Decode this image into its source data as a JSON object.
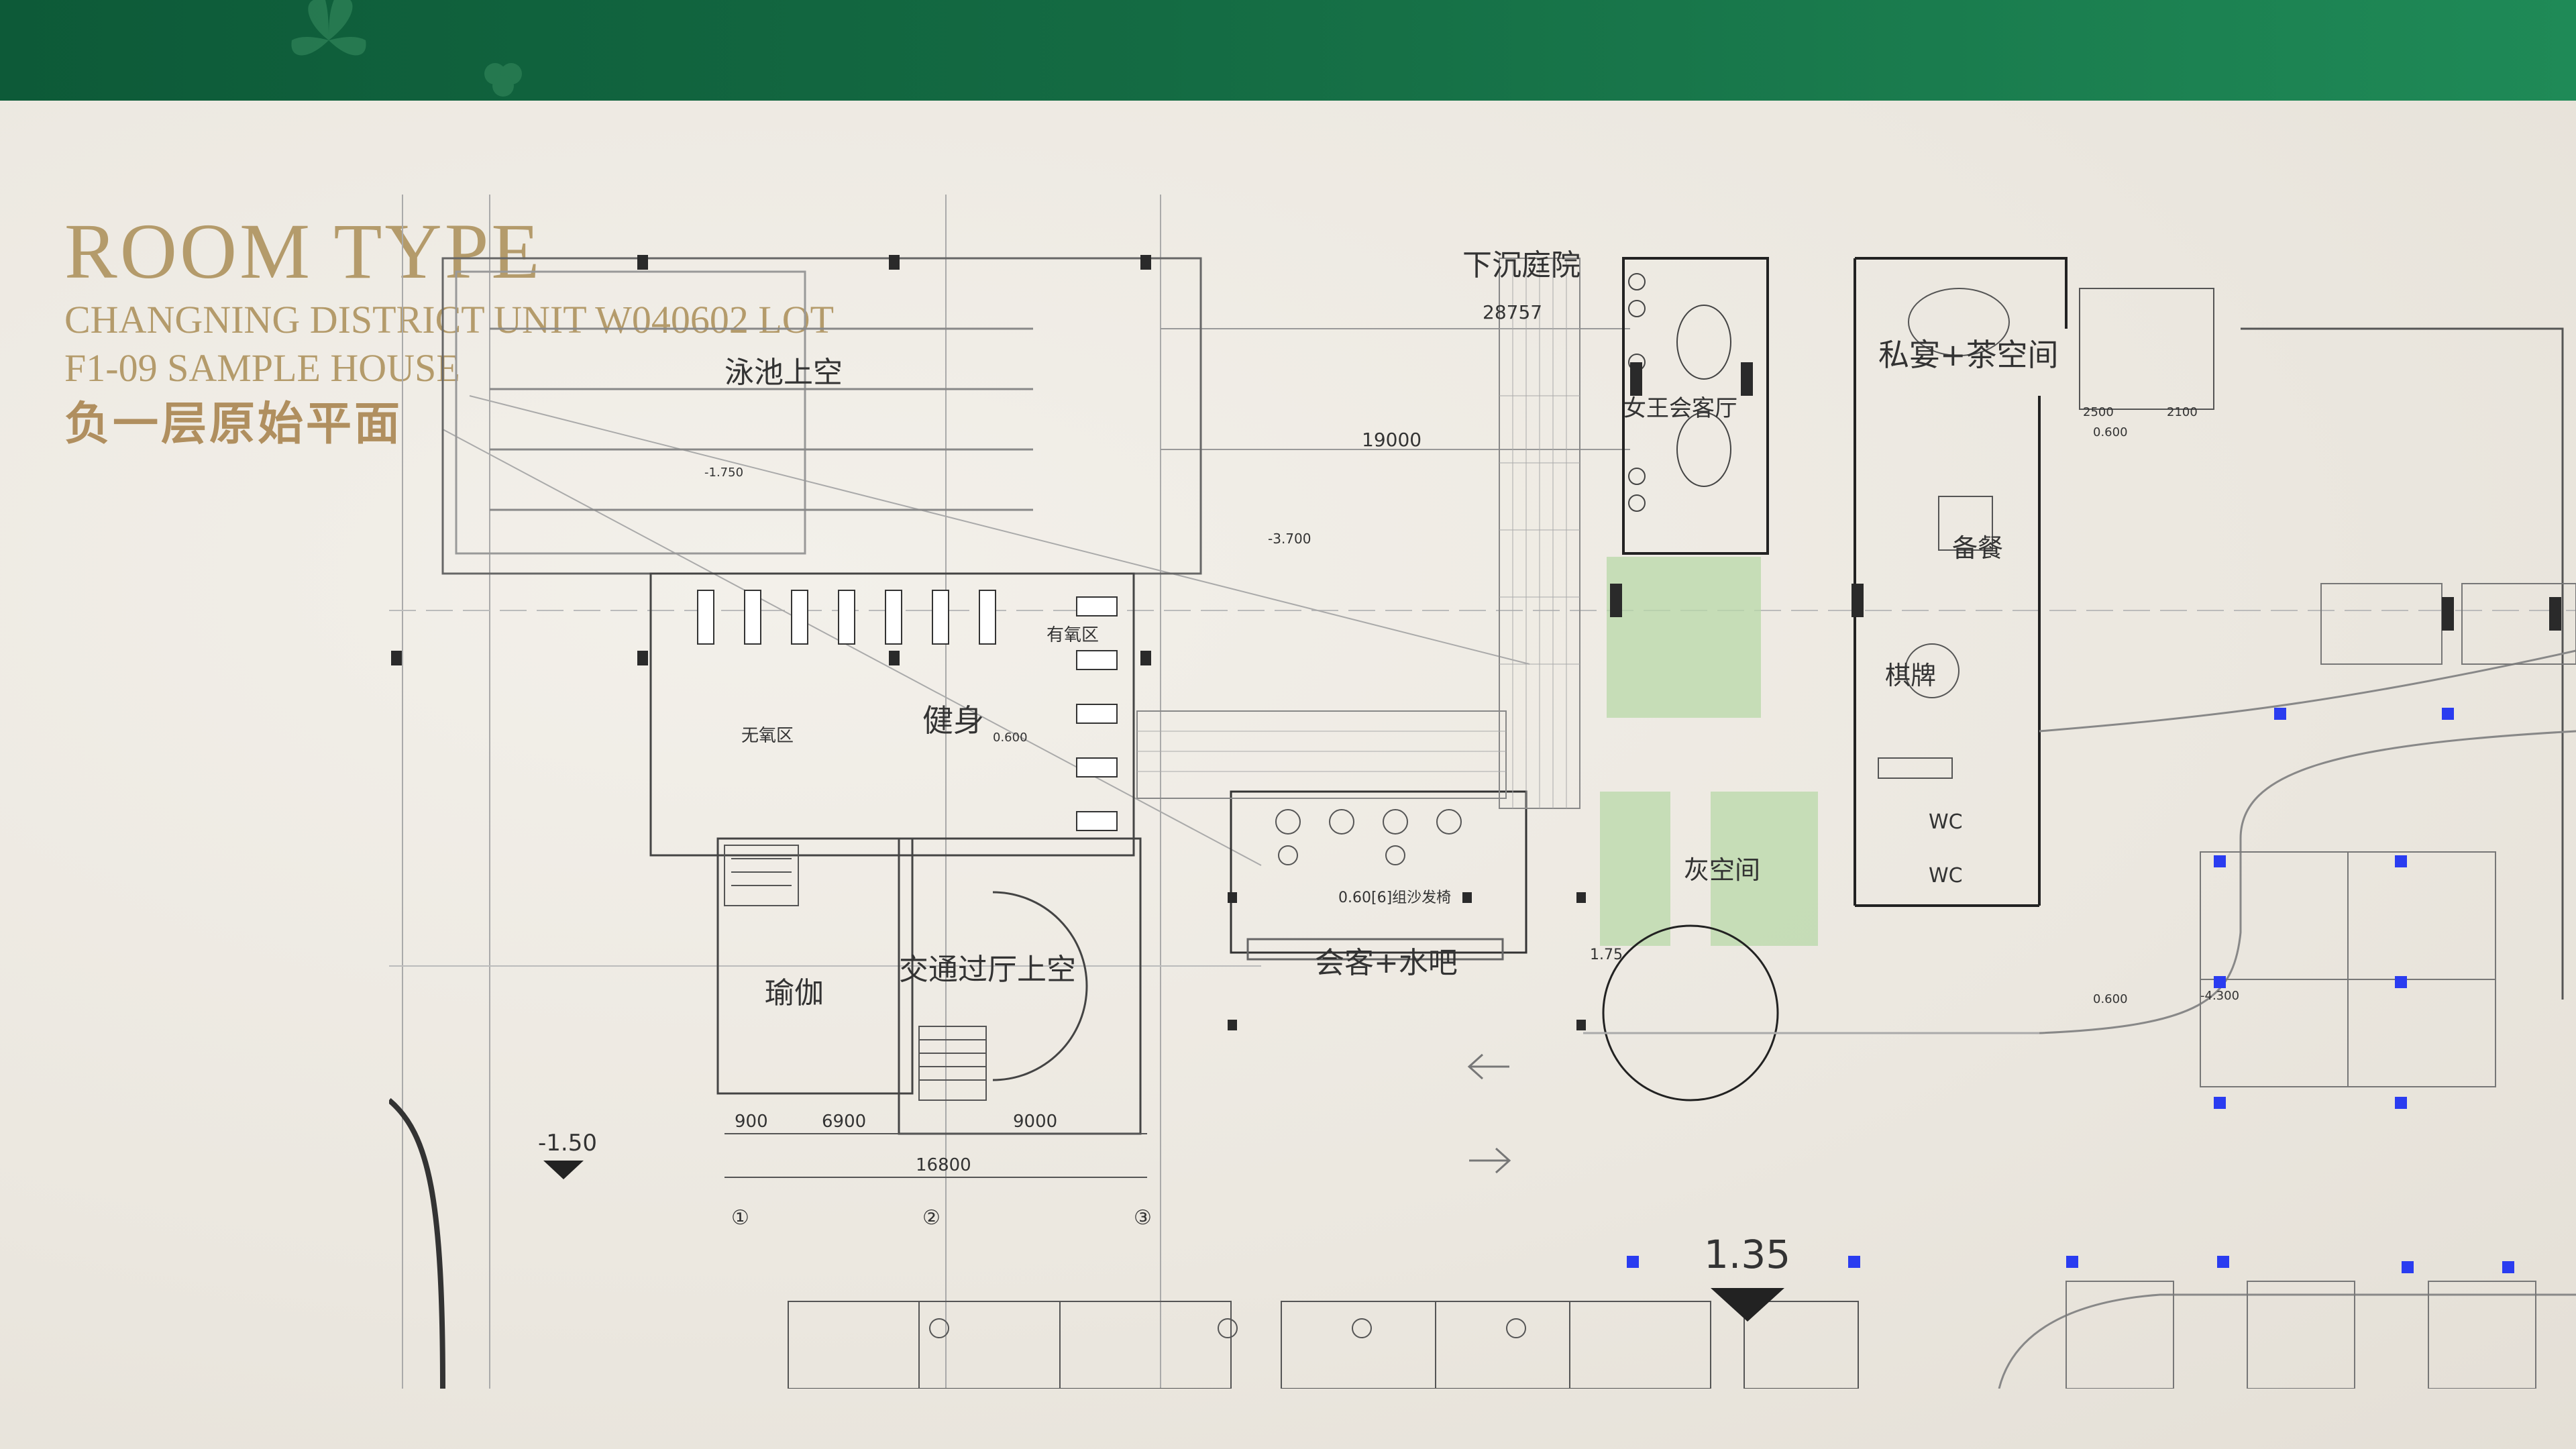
{
  "header": {
    "title": "ROOM TYPE",
    "subtitle_line1": "CHANGNING DISTRICT UNIT W040602 LOT",
    "subtitle_line2": "F1-09 SAMPLE HOUSE",
    "title_cn": "负一层原始平面"
  },
  "colors": {
    "banner": "#146b43",
    "title": "#b49b6b",
    "lawn": "#b8d8a8",
    "column": "#2a2a2a",
    "marker": "#2a3cf0"
  },
  "plan": {
    "rooms": {
      "pool_void": "泳池上空",
      "sunken_courtyard": "下沉庭院",
      "private_tea": "私宴+茶空间",
      "reception": "女王会客厅",
      "fitness": "健身",
      "aerobic": "有氧区",
      "anaerobic": "无氧区",
      "yoga": "瑜伽",
      "hall_void": "交通过厅上空",
      "lounge_bar": "会客+水吧",
      "grey_space": "灰空间",
      "chess": "棋牌",
      "pantry": "备餐",
      "wc1": "WC",
      "wc2": "WC",
      "sofa": "0.60[6]组沙发椅"
    },
    "dimensions": {
      "d1": "28757",
      "d2": "19000",
      "d3": "900",
      "d4": "6900",
      "d5": "9000",
      "d6": "16800",
      "d7": "2500",
      "d8": "2100"
    },
    "levels": {
      "l1": "-1.50",
      "l2": "1.35",
      "l3": "-3.700",
      "l4": "-1.750",
      "l5": "0.600",
      "l6": "-4.300",
      "l7": "0.600",
      "l8": "1.75",
      "l9": "0.600"
    },
    "grid_marks": [
      "①",
      "②",
      "③"
    ]
  }
}
